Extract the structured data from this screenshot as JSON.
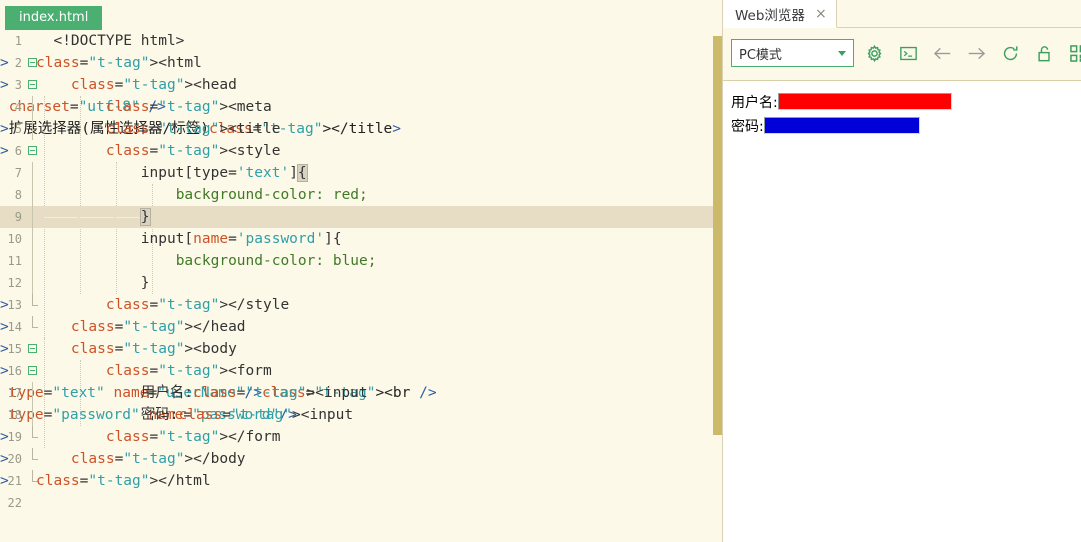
{
  "editor": {
    "tab_label": "index.html",
    "active_line": 9,
    "lines": [
      {
        "n": 1,
        "fold": "none",
        "text": "  <!DOCTYPE html>"
      },
      {
        "n": 2,
        "fold": "open",
        "text": "<html>"
      },
      {
        "n": 3,
        "fold": "open",
        "text": "    <head>"
      },
      {
        "n": 4,
        "fold": "bar",
        "text": "        <meta charset=\"utf-8\" />"
      },
      {
        "n": 5,
        "fold": "bar",
        "text": "        <title>扩展选择器(属性选择器/标签)</title>"
      },
      {
        "n": 6,
        "fold": "open",
        "text": "        <style>"
      },
      {
        "n": 7,
        "fold": "bar",
        "text": "            input[type='text']{"
      },
      {
        "n": 8,
        "fold": "bar",
        "text": "                background-color: red;"
      },
      {
        "n": 9,
        "fold": "bar",
        "text": "            }"
      },
      {
        "n": 10,
        "fold": "bar",
        "text": "            input[name='password']{"
      },
      {
        "n": 11,
        "fold": "bar",
        "text": "                background-color: blue;"
      },
      {
        "n": 12,
        "fold": "bar",
        "text": "            }"
      },
      {
        "n": 13,
        "fold": "end",
        "text": "        </style>"
      },
      {
        "n": 14,
        "fold": "end",
        "text": "    </head>"
      },
      {
        "n": 15,
        "fold": "open",
        "text": "    <body>"
      },
      {
        "n": 16,
        "fold": "open",
        "text": "        <form>"
      },
      {
        "n": 17,
        "fold": "bar",
        "text": "            用户名:<input type=\"text\" name=\"userName\"/><br />"
      },
      {
        "n": 18,
        "fold": "bar",
        "text": "            密码:<input type=\"password\" name=\"password\"/>"
      },
      {
        "n": 19,
        "fold": "end",
        "text": "        </form>"
      },
      {
        "n": 20,
        "fold": "end",
        "text": "    </body>"
      },
      {
        "n": 21,
        "fold": "end",
        "text": "</html>"
      },
      {
        "n": 22,
        "fold": "none",
        "text": ""
      }
    ]
  },
  "browser": {
    "tab_label": "Web浏览器",
    "tab_close": "×",
    "toolbar": {
      "mode_value": "PC模式",
      "icons": [
        {
          "name": "gear-icon",
          "title": "设置"
        },
        {
          "name": "console-icon",
          "title": "控制台"
        },
        {
          "name": "back-icon",
          "title": "后退"
        },
        {
          "name": "forward-icon",
          "title": "前进"
        },
        {
          "name": "refresh-icon",
          "title": "刷新"
        },
        {
          "name": "lock-icon",
          "title": "锁定"
        },
        {
          "name": "qrcode-icon",
          "title": "二维码"
        }
      ]
    },
    "page": {
      "username_label": "用户名:",
      "password_label": "密码:",
      "username_value": "",
      "password_value": ""
    }
  },
  "colors": {
    "editor_bg": "#fdf9e8",
    "tab_green": "#4caf72",
    "active_line": "#e6ddc4",
    "scrollbar": "#cdb96a",
    "tag": "#2b5ea7",
    "attr": "#cc5327",
    "value": "#2f9fa8",
    "property": "#3f7a26",
    "input_red": "#ff0000",
    "input_blue": "#0000d8"
  }
}
